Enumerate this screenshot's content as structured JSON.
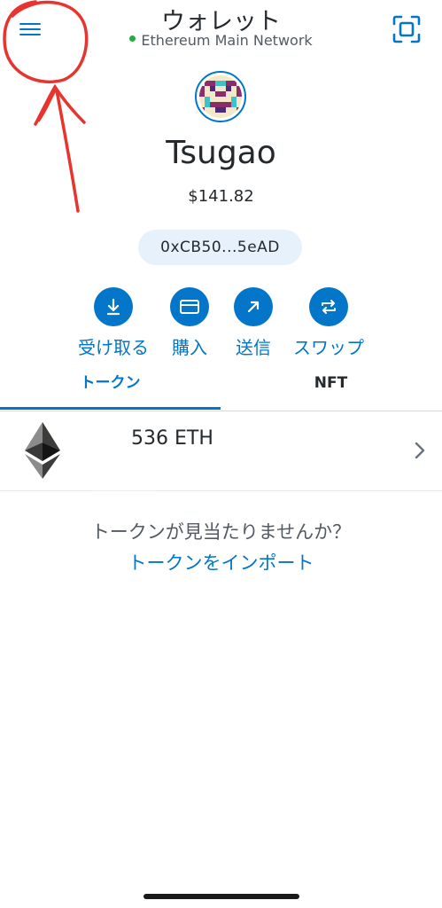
{
  "header": {
    "title": "ウォレット",
    "network": "Ethereum Main Network",
    "menu_icon": "hamburger-menu-icon",
    "scan_icon": "qr-scan-icon"
  },
  "account": {
    "name": "Tsugao",
    "balance": "$141.82",
    "address": "0xCB50...5eAD"
  },
  "actions": [
    {
      "label": "受け取る",
      "icon": "receive-icon"
    },
    {
      "label": "購入",
      "icon": "buy-card-icon"
    },
    {
      "label": "送信",
      "icon": "send-arrow-icon"
    },
    {
      "label": "スワップ",
      "icon": "swap-icon"
    }
  ],
  "tabs": [
    {
      "label": "トークン",
      "active": true
    },
    {
      "label": "NFT",
      "active": false
    }
  ],
  "tokens": [
    {
      "amount": "536 ETH",
      "icon": "ethereum-icon"
    }
  ],
  "empty": {
    "question": "トークンが見当たりませんか？",
    "import_link": "トークンをインポート"
  },
  "colors": {
    "accent": "#0376c9",
    "annotation": "#e8342f"
  }
}
